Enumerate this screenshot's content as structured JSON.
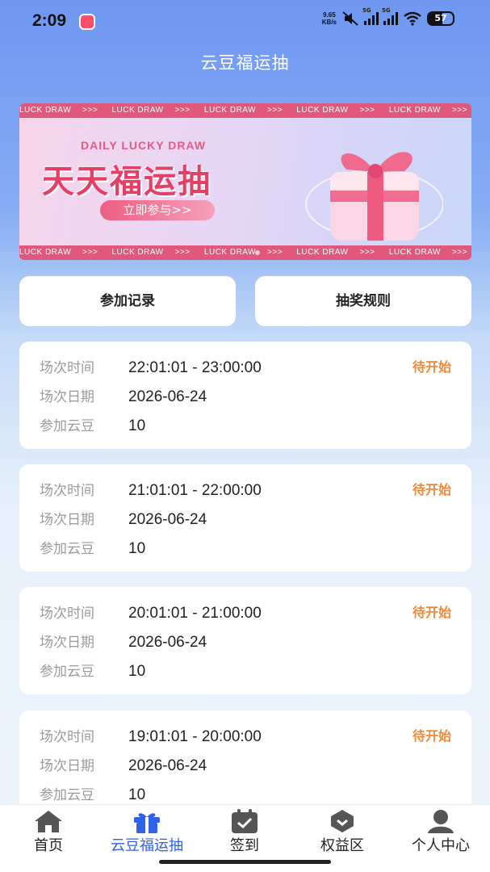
{
  "status_bar": {
    "time": "2:09",
    "net_speed_value": "9.65",
    "net_speed_unit": "KB/s",
    "signal1_label": "5G",
    "signal2_label": "5G",
    "battery": "57"
  },
  "header": {
    "title": "云豆福运抽"
  },
  "banner": {
    "strip_text": "LUCK DRAW",
    "strip_arrow": ">>>",
    "subtitle": "DAILY LUCKY DRAW",
    "title": "天天福运抽",
    "cta": "立即参与>>"
  },
  "actions": {
    "records": "参加记录",
    "rules": "抽奖规则"
  },
  "labels": {
    "time": "场次时间",
    "date": "场次日期",
    "beans": "参加云豆"
  },
  "sessions": [
    {
      "time": "22:01:01 - 23:00:00",
      "date": "2026-06-24",
      "beans": "10",
      "status": "待开始"
    },
    {
      "time": "21:01:01 - 22:00:00",
      "date": "2026-06-24",
      "beans": "10",
      "status": "待开始"
    },
    {
      "time": "20:01:01 - 21:00:00",
      "date": "2026-06-24",
      "beans": "10",
      "status": "待开始"
    },
    {
      "time": "19:01:01 - 20:00:00",
      "date": "2026-06-24",
      "beans": "10",
      "status": "待开始"
    }
  ],
  "nav": [
    {
      "label": "首页",
      "icon": "home-icon"
    },
    {
      "label": "云豆福运抽",
      "icon": "gift-icon"
    },
    {
      "label": "签到",
      "icon": "calendar-check-icon"
    },
    {
      "label": "权益区",
      "icon": "badge-icon"
    },
    {
      "label": "个人中心",
      "icon": "user-icon"
    }
  ],
  "colors": {
    "accent": "#2f62e6",
    "status": "#ee8a3c",
    "banner_pink": "#e43f66"
  }
}
